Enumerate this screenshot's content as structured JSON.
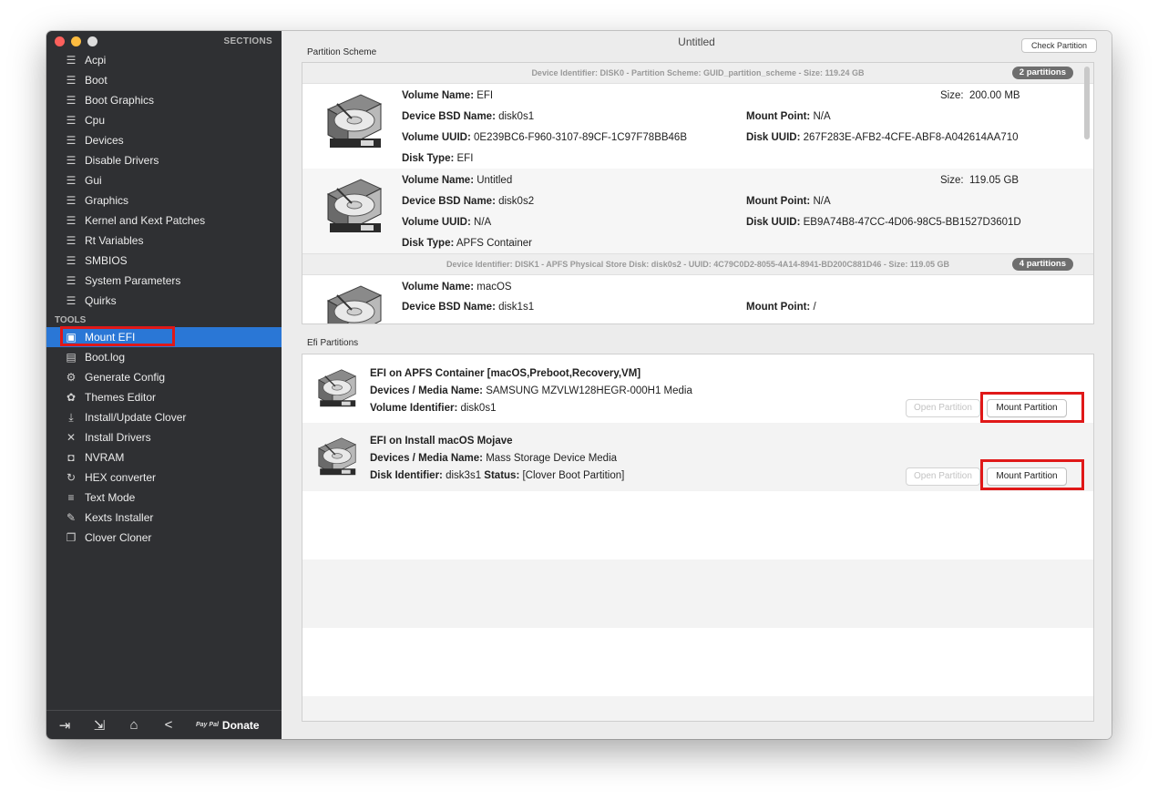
{
  "window": {
    "title": "Untitled",
    "check_partition_label": "Check Partition",
    "traffic_colors": [
      "#fc605c",
      "#fdbc40",
      "#dddddd"
    ]
  },
  "sidebar": {
    "sections_title": "SECTIONS",
    "sections": [
      {
        "label": "Acpi"
      },
      {
        "label": "Boot"
      },
      {
        "label": "Boot Graphics"
      },
      {
        "label": "Cpu"
      },
      {
        "label": "Devices"
      },
      {
        "label": "Disable Drivers"
      },
      {
        "label": "Gui"
      },
      {
        "label": "Graphics"
      },
      {
        "label": "Kernel and Kext Patches"
      },
      {
        "label": "Rt Variables"
      },
      {
        "label": "SMBIOS"
      },
      {
        "label": "System Parameters"
      },
      {
        "label": "Quirks"
      }
    ],
    "tools_title": "TOOLS",
    "tools": [
      {
        "label": "Mount EFI",
        "icon": "disk-icon"
      },
      {
        "label": "Boot.log",
        "icon": "log-search-icon"
      },
      {
        "label": "Generate Config",
        "icon": "gears-icon"
      },
      {
        "label": "Themes Editor",
        "icon": "palette-icon"
      },
      {
        "label": "Install/Update Clover",
        "icon": "download-icon"
      },
      {
        "label": "Install Drivers",
        "icon": "tools-icon"
      },
      {
        "label": "NVRAM",
        "icon": "chip-icon"
      },
      {
        "label": "HEX converter",
        "icon": "refresh-icon"
      },
      {
        "label": "Text Mode",
        "icon": "text-lines-icon"
      },
      {
        "label": "Kexts Installer",
        "icon": "plugin-icon"
      },
      {
        "label": "Clover Cloner",
        "icon": "clone-icon"
      }
    ],
    "footer": {
      "donate_label": "Donate",
      "paypal_label": "Pay Pal"
    },
    "accent_color": "#2a77d6"
  },
  "partition_scheme": {
    "label": "Partition Scheme",
    "disks": [
      {
        "header": "Device Identifier: DISK0 - Partition Scheme: GUID_partition_scheme - Size: 119.24 GB",
        "badge": "2 partitions",
        "volumes": [
          {
            "volume_name_label": "Volume Name:",
            "volume_name": "EFI",
            "size_label": "Size:",
            "size": "200.00 MB",
            "bsd_label": "Device BSD Name:",
            "bsd": "disk0s1",
            "mount_label": "Mount Point:",
            "mount": "N/A",
            "uuid_label": "Volume UUID:",
            "uuid": "0E239BC6-F960-3107-89CF-1C97F78BB46B",
            "disk_uuid_label": "Disk UUID:",
            "disk_uuid": "267F283E-AFB2-4CFE-ABF8-A042614AA710",
            "type_label": "Disk Type:",
            "type": "EFI"
          },
          {
            "volume_name_label": "Volume Name:",
            "volume_name": "Untitled",
            "size_label": "Size:",
            "size": "119.05 GB",
            "bsd_label": "Device BSD Name:",
            "bsd": "disk0s2",
            "mount_label": "Mount Point:",
            "mount": "N/A",
            "uuid_label": "Volume UUID:",
            "uuid": "N/A",
            "disk_uuid_label": "Disk UUID:",
            "disk_uuid": "EB9A74B8-47CC-4D06-98C5-BB1527D3601D",
            "type_label": "Disk Type:",
            "type": "APFS Container"
          }
        ]
      },
      {
        "header": "Device Identifier: DISK1 - APFS Physical Store Disk: disk0s2 - UUID: 4C79C0D2-8055-4A14-8941-BD200C881D46 - Size: 119.05 GB",
        "badge": "4 partitions",
        "volumes": [
          {
            "volume_name_label": "Volume Name:",
            "volume_name": "macOS",
            "bsd_label": "Device BSD Name:",
            "bsd": "disk1s1",
            "mount_label": "Mount Point:",
            "mount": "/"
          }
        ]
      }
    ]
  },
  "efi_partitions": {
    "label": "Efi Partitions",
    "items": [
      {
        "title": "EFI on APFS Container [macOS,Preboot,Recovery,VM]",
        "media_label": "Devices / Media Name:",
        "media": "SAMSUNG MZVLW128HEGR-000H1 Media",
        "id_label": "Volume Identifier:",
        "id": "disk0s1",
        "open_label": "Open Partition",
        "mount_label": "Mount Partition"
      },
      {
        "title": "EFI on Install macOS Mojave",
        "media_label": "Devices / Media Name:",
        "media": "Mass Storage Device Media",
        "id_label": "Disk Identifier:",
        "id": "disk3s1",
        "status_label": "Status:",
        "status": "[Clover Boot Partition]",
        "open_label": "Open Partition",
        "mount_label": "Mount Partition"
      }
    ]
  },
  "highlight_color": "#e01818"
}
